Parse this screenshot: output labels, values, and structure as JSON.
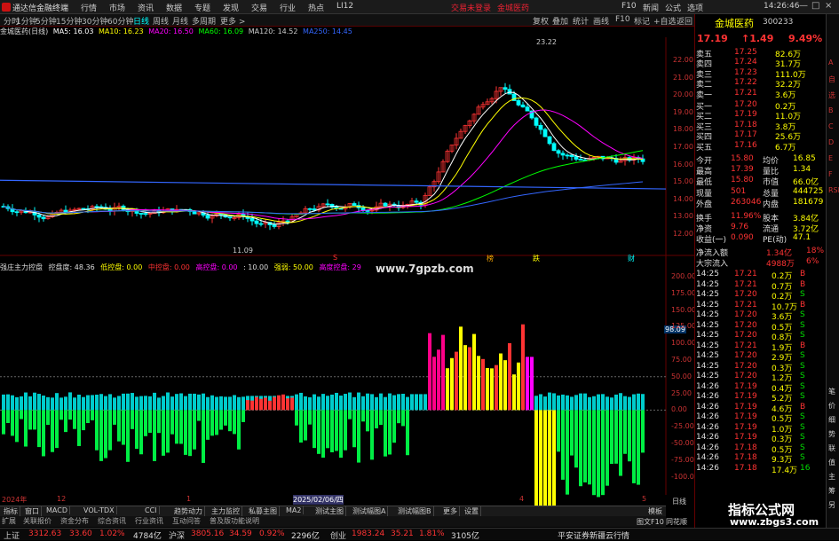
{
  "window": {
    "app_title": "通达信金融终端",
    "alert1": "交易未登录",
    "alert2": "金城医药",
    "time": "14:26:46",
    "ctl_min": "—",
    "ctl_max": "□",
    "ctl_close": "×"
  },
  "menu": [
    "行情",
    "市场",
    "资讯",
    "数据",
    "专题",
    "发现",
    "交易",
    "行业",
    "热点",
    "LI12"
  ],
  "top_right_menu": [
    "F10",
    "新闻",
    "公式",
    "选项"
  ],
  "toolbar": {
    "periods": [
      "分时",
      "1分钟",
      "5分钟",
      "15分钟",
      "30分钟",
      "60分钟",
      "日线",
      "周线",
      "月线",
      "多周期",
      "更多 >"
    ],
    "active": "日线",
    "right": [
      "复权",
      "叠加",
      "统计",
      "画线",
      "F10",
      "标记",
      "+自选",
      "返回"
    ]
  },
  "ma": {
    "name": "金城医药(日线)",
    "ma5": "MA5: 16.03",
    "ma10": "MA10: 16.23",
    "ma20": "MA20: 16.50",
    "ma60": "MA60: 16.09",
    "ma120": "MA120: 14.52",
    "ma250": "MA250: 14.45"
  },
  "price_axis": [
    "22.00",
    "21.00",
    "20.00",
    "19.00",
    "18.00",
    "17.00",
    "16.00",
    "15.00",
    "14.00",
    "13.00",
    "12.00"
  ],
  "price_annotations": {
    "high": "23.22",
    "low": "11.09"
  },
  "markers": [
    "S",
    "榜",
    "跌",
    "财"
  ],
  "indicator": {
    "name": "强庄主力控盘",
    "ctrl": "控盘度: 48.36",
    "low": "低控盘: 0.00",
    "mid": "中控盘: 0.00",
    "high": "高控盘: 0.00",
    "v10": ": 10.00",
    "strong": "强弱: 50.00",
    "hi": "高度控盘: 29"
  },
  "ind_axis": [
    "200.00",
    "175.00",
    "150.00",
    "125.00",
    "100.00",
    "75.00",
    "50.00",
    "25.00",
    "0.00",
    "-25.00",
    "-50.00",
    "-75.00",
    "-100.00"
  ],
  "ind_marker": "98.09",
  "watermark": "www.7gpzb.com",
  "time_axis": [
    "2024年",
    "12",
    "1",
    "2025/02/06/四",
    "4",
    "5"
  ],
  "bottom_tabs": [
    "指标",
    "窗口",
    "MACD",
    "VOL-TDX",
    "CCI",
    "趋势动力",
    "主力监控",
    "私募主图",
    "MA2",
    "测试主图",
    "测试幅图A",
    "测试幅图B",
    "更多",
    "设置"
  ],
  "bottom_tabs2": [
    "扩展",
    "关联报价",
    "资金分布",
    "综合资讯",
    "行业资讯",
    "互动问答",
    "普及版功能说明"
  ],
  "bottom_right": [
    "模板",
    "日线",
    "图文F10",
    "同花顺",
    "—"
  ],
  "status": {
    "sh_label": "上证",
    "sh_val": "3312.63",
    "sh_chg": "33.60",
    "sh_pct": "1.02%",
    "sh_amt": "4784亿",
    "hs_label": "沪深",
    "hs_val": "3805.16",
    "hs_chg": "34.59",
    "hs_pct": "0.92%",
    "hs_amt": "2296亿",
    "cy_label": "创业",
    "cy_val": "1983.24",
    "cy_chg": "35.21",
    "cy_pct": "1.81%",
    "cy_amt": "3105亿",
    "broker": "平安证券新疆云行情"
  },
  "quote": {
    "name": "金城医药",
    "code": "300233",
    "price": "17.19",
    "chg": "↑1.49",
    "pct": "9.49%",
    "asks": [
      [
        "卖五",
        "17.25",
        "82.6万"
      ],
      [
        "卖四",
        "17.24",
        "31.7万"
      ],
      [
        "卖三",
        "17.23",
        "111.0万"
      ],
      [
        "卖二",
        "17.22",
        "32.2万"
      ],
      [
        "卖一",
        "17.21",
        "3.6万"
      ]
    ],
    "bids": [
      [
        "买一",
        "17.20",
        "0.2万"
      ],
      [
        "买二",
        "17.19",
        "11.0万"
      ],
      [
        "买三",
        "17.18",
        "3.8万"
      ],
      [
        "买四",
        "17.17",
        "25.6万"
      ],
      [
        "买五",
        "17.16",
        "6.7万"
      ]
    ],
    "stats": [
      [
        "今开",
        "15.80",
        "均价",
        "16.85"
      ],
      [
        "最高",
        "17.39",
        "量比",
        "1.34"
      ],
      [
        "最低",
        "15.80",
        "市值",
        "66.0亿"
      ],
      [
        "现量",
        "501",
        "总量",
        "444725"
      ],
      [
        "外盘",
        "263046",
        "内盘",
        "181679"
      ],
      [
        "换手",
        "11.96%",
        "股本",
        "3.84亿"
      ],
      [
        "净资",
        "9.76",
        "流通",
        "3.72亿"
      ],
      [
        "收益(一)",
        "0.090",
        "PE(动)",
        "47.1"
      ]
    ],
    "flows": [
      [
        "净流入额",
        "1.34亿",
        "18%"
      ],
      [
        "大宗流入",
        "4988万",
        "6%"
      ]
    ],
    "ticks": [
      [
        "14:25",
        "17.21",
        "0.2万",
        "B"
      ],
      [
        "14:25",
        "17.21",
        "0.7万",
        "B"
      ],
      [
        "14:25",
        "17.20",
        "0.2万",
        "S"
      ],
      [
        "14:25",
        "17.21",
        "10.7万",
        "B"
      ],
      [
        "14:25",
        "17.20",
        "3.6万",
        "S"
      ],
      [
        "14:25",
        "17.20",
        "0.5万",
        "S"
      ],
      [
        "14:25",
        "17.20",
        "0.8万",
        "S"
      ],
      [
        "14:25",
        "17.21",
        "1.9万",
        "B"
      ],
      [
        "14:25",
        "17.20",
        "2.9万",
        "S"
      ],
      [
        "14:25",
        "17.20",
        "0.3万",
        "S"
      ],
      [
        "14:25",
        "17.20",
        "1.2万",
        "S"
      ],
      [
        "14:26",
        "17.19",
        "0.4万",
        "S"
      ],
      [
        "14:26",
        "17.19",
        "5.2万",
        "S"
      ],
      [
        "14:26",
        "17.19",
        "4.6万",
        "B"
      ],
      [
        "14:26",
        "17.19",
        "0.5万",
        "S"
      ],
      [
        "14:26",
        "17.19",
        "1.0万",
        "S"
      ],
      [
        "14:26",
        "17.19",
        "0.3万",
        "S"
      ],
      [
        "14:26",
        "17.18",
        "0.5万",
        "S"
      ],
      [
        "14:26",
        "17.18",
        "9.3万",
        "S"
      ],
      [
        "14:26",
        "17.18",
        "17.4万",
        "16"
      ]
    ],
    "tabs": [
      "笔",
      "价",
      "细",
      "势",
      "联",
      "值",
      "主",
      "筹",
      "另"
    ]
  },
  "side_strip": [
    "A",
    "自",
    "选",
    "B",
    "C",
    "D",
    "E",
    "F",
    "RSI"
  ],
  "footer_logo": {
    "title": "指标公式网",
    "url": "www.zbgs3.com"
  }
}
